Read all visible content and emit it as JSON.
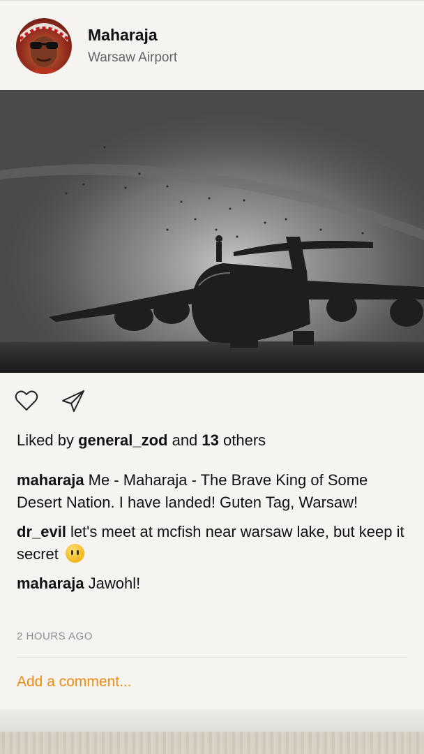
{
  "post": {
    "username": "Maharaja",
    "location": "Warsaw Airport",
    "likes": {
      "prefix": "Liked by",
      "user": "general_zod",
      "middle": "and",
      "count": "13",
      "suffix": "others"
    },
    "comments": [
      {
        "user": "maharaja",
        "text": "Me - Maharaja - The Brave King of Some Desert Nation. I have landed! Guten Tag, Warsaw!"
      },
      {
        "user": "dr_evil",
        "text": "let's meet at mcfish near warsaw lake, but keep it secret",
        "emoji": "face-without-mouth-emoji"
      },
      {
        "user": "maharaja",
        "text": "Jawohl!"
      }
    ],
    "timestamp": "2 HOURS AGO",
    "add_comment_placeholder": "Add a comment..."
  },
  "icons": {
    "like": "heart-outline-icon",
    "share": "paper-plane-icon"
  },
  "colors": {
    "accent": "#ef8a12",
    "background": "#f5f4f1",
    "muted_text": "#8e8e8e"
  }
}
